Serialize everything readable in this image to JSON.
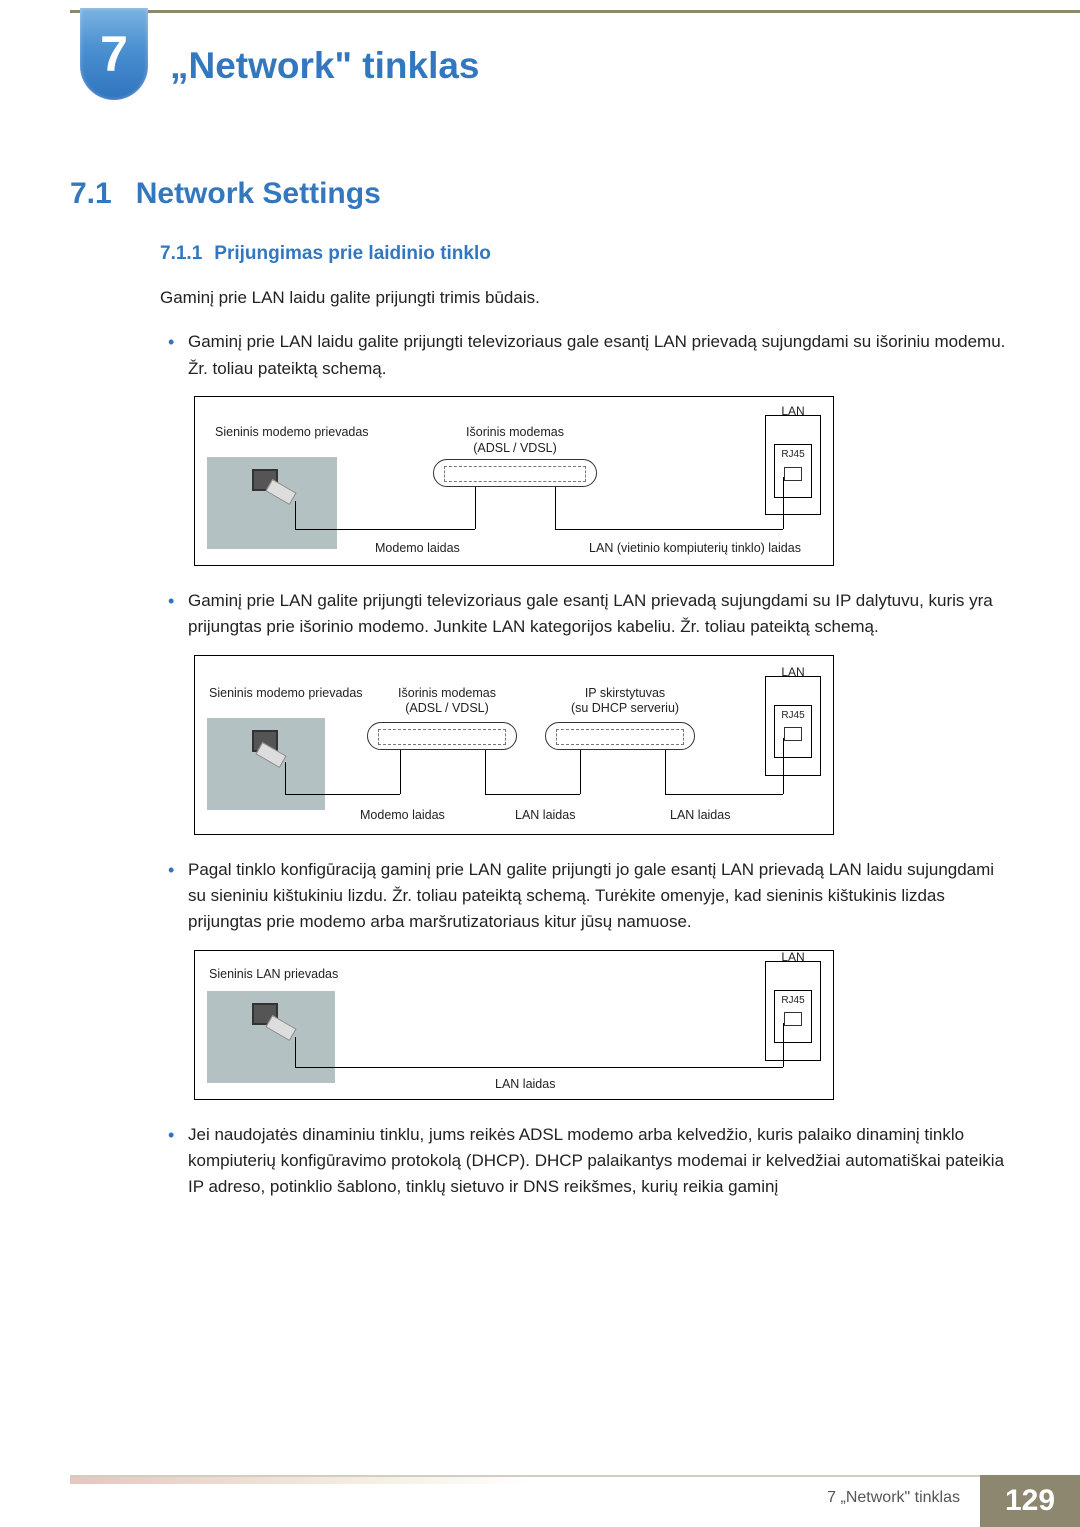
{
  "chapter": {
    "number": "7",
    "title": "„Network\" tinklas"
  },
  "section": {
    "number": "7.1",
    "title": "Network Settings"
  },
  "subsection": {
    "number": "7.1.1",
    "title": "Prijungimas prie laidinio tinklo"
  },
  "intro": "Gaminį prie LAN laidu galite prijungti trimis būdais.",
  "bullets": {
    "b1": "Gaminį prie LAN laidu galite prijungti televizoriaus gale esantį LAN prievadą sujungdami su išoriniu modemu. Žr. toliau pateiktą schemą.",
    "b2": "Gaminį prie LAN galite prijungti televizoriaus gale esantį LAN prievadą sujungdami su IP dalytuvu, kuris yra prijungtas prie išorinio modemo. Junkite LAN kategorijos kabeliu. Žr. toliau pateiktą schemą.",
    "b3": "Pagal tinklo konfigūraciją gaminį prie LAN galite prijungti jo gale esantį LAN prievadą LAN laidu sujungdami su sieniniu kištukiniu lizdu. Žr. toliau pateiktą schemą. Turėkite omenyje, kad sieninis kištukinis lizdas prijungtas prie modemo arba maršrutizatoriaus kitur jūsų namuose.",
    "b4": "Jei naudojatės dinaminiu tinklu, jums reikės ADSL modemo arba kelvedžio, kuris palaiko dinaminį tinklo kompiuterių konfigūravimo protokolą (DHCP). DHCP palaikantys modemai ir kelvedžiai automatiškai pateikia IP adreso, potinklio šablono, tinklų sietuvo ir DNS reikšmes, kurių reikia gaminį"
  },
  "diagram_labels": {
    "wall_port": "Sieninis modemo prievadas",
    "wall_lan_port": "Sieninis LAN prievadas",
    "ext_modem": "Išorinis modemas",
    "adsl": "(ADSL / VDSL)",
    "ip_router": "IP skirstytuvas",
    "ip_router_sub": "(su DHCP serveriu)",
    "modem_cable": "Modemo laidas",
    "lan_cable_long": "LAN (vietinio kompiuterių tinklo) laidas",
    "lan_cable": "LAN laidas",
    "lan": "LAN",
    "rj45": "RJ45"
  },
  "footer": {
    "text": "7 „Network\" tinklas",
    "page": "129"
  }
}
